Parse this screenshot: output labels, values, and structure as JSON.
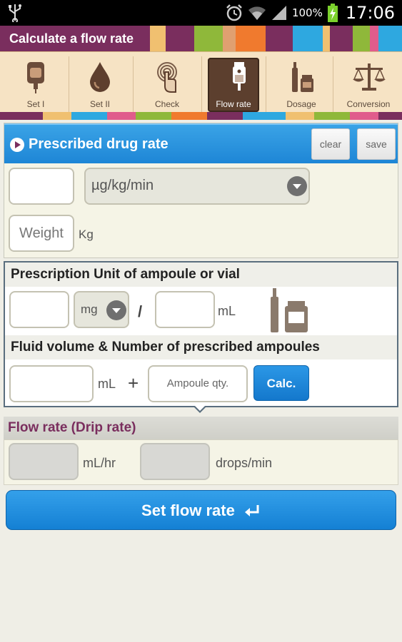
{
  "status_bar": {
    "battery": "100%",
    "time": "17:06"
  },
  "title": "Calculate a flow rate",
  "toolbar": {
    "items": [
      {
        "label": "Set I",
        "icon": "iv-bag-icon",
        "active": false
      },
      {
        "label": "Set II",
        "icon": "drop-icon",
        "active": false
      },
      {
        "label": "Check",
        "icon": "fingerprint-touch-icon",
        "active": false
      },
      {
        "label": "Flow rate",
        "icon": "drip-chamber-icon",
        "active": true
      },
      {
        "label": "Dosage",
        "icon": "vial-ampoule-icon",
        "active": false
      },
      {
        "label": "Conversion",
        "icon": "scale-icon",
        "active": false
      }
    ]
  },
  "prescribed": {
    "title": "Prescribed drug rate",
    "clear_label": "clear",
    "save_label": "save",
    "rate_value": "",
    "rate_unit": "µg/kg/min",
    "weight_placeholder": "Weight",
    "weight_unit": "Kg"
  },
  "prescription": {
    "unit_title": "Prescription Unit of ampoule or vial",
    "amount_value": "",
    "amount_unit": "mg",
    "divider": "/",
    "volume_value": "",
    "volume_unit": "mL",
    "fluid_title": "Fluid volume & Number of prescribed ampoules",
    "fluid_value": "",
    "fluid_unit": "mL",
    "plus": "+",
    "ampoule_placeholder": "Ampoule qty.",
    "calc_label": "Calc."
  },
  "flow_rate": {
    "title": "Flow rate (Drip rate)",
    "ml_hr_value": "",
    "ml_hr_unit": "mL/hr",
    "drops_value": "",
    "drops_unit": "drops/min"
  },
  "set_flow_rate_label": "Set flow rate",
  "colors": {
    "accent_blue": "#1e86d6",
    "brand_plum": "#7a2e5e",
    "toolbar_bg": "#f6e3c4",
    "active_tool": "#5c3f2e"
  }
}
